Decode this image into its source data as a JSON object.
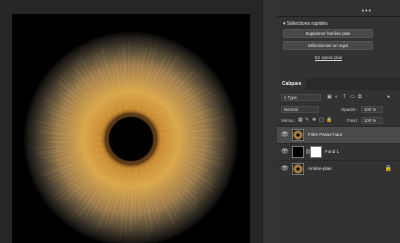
{
  "canvas": {
    "bg": "#000000",
    "iris_colors": [
      "#d4a24a",
      "#b07a33",
      "#7a5a34",
      "#2a2520"
    ]
  },
  "panel": {
    "menu_dots": "•••",
    "quick_actions": {
      "title": "Sélections rapides",
      "btn_remove_bg": "Supprimer l'arrière-plan",
      "btn_select_subject": "Sélectionner un sujet",
      "link_more": "En savoir plus"
    },
    "layers_tab": "Calques",
    "filter": {
      "value": "Type"
    },
    "blend": {
      "mode": "Normal",
      "opacity_label": "Opacité :",
      "opacity_value": "100 %"
    },
    "lock": {
      "label": "Verrou :",
      "fill_label": "Fond :",
      "fill_value": "100 %"
    },
    "layers": [
      {
        "name": "Filtre Passe-haut",
        "active": true
      },
      {
        "name": "Fond 1",
        "active": false
      },
      {
        "name": "Arrière-plan",
        "active": false
      }
    ]
  }
}
